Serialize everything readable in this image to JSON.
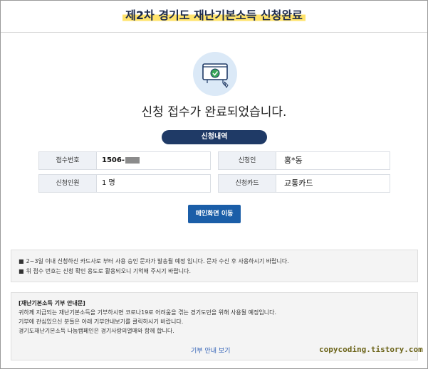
{
  "header": {
    "title": "제2차 경기도 재난기본소득 신청완료"
  },
  "hero": {
    "message": "신청 접수가 완료되었습니다."
  },
  "section": {
    "label": "신청내역"
  },
  "fields": {
    "receipt": {
      "label": "접수번호",
      "value": "1506-"
    },
    "applicant": {
      "label": "신청인",
      "value": "홍*동"
    },
    "count": {
      "label": "신청인원",
      "value": "1 명"
    },
    "card": {
      "label": "신청카드",
      "value": "교통카드"
    }
  },
  "main_button": {
    "label": "메인화면 이동"
  },
  "notice": {
    "lines": [
      "2~3일 이내 신청하신 카드사로 부터 사용 승인 문자가 발송될 예정 입니다. 문자 수신 후 사용하시기 바랍니다.",
      "위 접수 번호는 신청 확인 용도로 활용되오니 기억해 주시기 바랍니다."
    ],
    "bullet": "■"
  },
  "donation": {
    "title": "[재난기본소득 기부 안내문]",
    "lines": [
      "귀하께 지급되는 재난기본소득을 기부하시면 코로나19로 어려움을 겪는 경기도민을 위해 사용될 예정입니다.",
      "기부에 관심있으신 분들은 아래 기부안내보기를 클릭하시기 바랍니다.",
      "경기도재난기본소득 나눔캠페인은 경기사랑의열매와 함께 합니다."
    ],
    "link_label": "기부 안내 보기"
  },
  "watermark": "copycoding.tistory.com",
  "icons": {
    "hero": "monitor-check-icon"
  },
  "colors": {
    "accent": "#1f3a66",
    "button": "#1b5ea8",
    "highlight": "#ffe36b",
    "check": "#3aa657"
  }
}
